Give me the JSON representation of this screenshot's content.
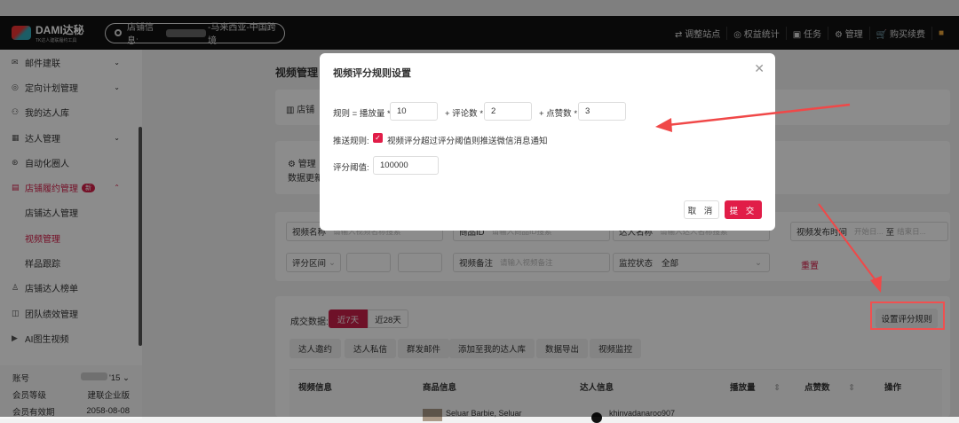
{
  "header": {
    "logo_title": "DAMI达秘",
    "logo_subtitle": "TK达人建联履约工具",
    "store_label": "店铺信息:",
    "store_value": "-马来西亚-中国跨境",
    "nav": [
      "调整站点",
      "权益统计",
      "任务",
      "管理",
      "购买续费"
    ]
  },
  "sidebar": {
    "items": [
      {
        "label": "邮件建联",
        "icon": "mail-icon",
        "chevron": "⌄"
      },
      {
        "label": "定向计划管理",
        "icon": "target-icon",
        "chevron": "⌄"
      },
      {
        "label": "我的达人库",
        "icon": "user-icon"
      },
      {
        "label": "达人管理",
        "icon": "grid-icon",
        "chevron": "⌄"
      },
      {
        "label": "自动化圈人",
        "icon": "auto-icon"
      },
      {
        "label": "店铺履约管理",
        "icon": "store-icon",
        "badge": "新",
        "chevron": "⌃"
      },
      {
        "label": "店铺达人管理"
      },
      {
        "label": "视频管理"
      },
      {
        "label": "样品跟踪"
      },
      {
        "label": "店铺达人榜单",
        "icon": "rank-icon"
      },
      {
        "label": "团队绩效管理",
        "icon": "team-icon"
      },
      {
        "label": "AI图生视频",
        "icon": "video-icon"
      }
    ],
    "account": {
      "account_label": "账号",
      "account_value": "'15",
      "level_label": "会员等级",
      "level_value": "建联企业版",
      "expire_label": "会员有效期",
      "expire_value": "2058-08-08"
    }
  },
  "main": {
    "title": "视频管理",
    "store_tab": "店铺",
    "manage_label": "管理",
    "data_update": "数据更新",
    "filters": {
      "video_name": "视频名称",
      "video_name_ph": "请输入视频名称搜索",
      "product_id": "商品ID",
      "product_id_ph": "请输入商品ID搜索",
      "creator_name": "达人名称",
      "creator_name_ph": "请输入达人名称搜索",
      "publish_time": "视频发布时间",
      "start_ph": "开始日...",
      "to": "至",
      "end_ph": "结束日...",
      "score_range": "评分区间",
      "video_note": "视频备注",
      "video_note_ph": "请输入视频备注",
      "monitor_status": "监控状态",
      "monitor_value": "全部",
      "reset": "重置"
    },
    "deal_label": "成交数据:",
    "range_tabs": [
      "近7天",
      "近28天"
    ],
    "set_rule": "设置评分规则",
    "actions": [
      "达人邀约",
      "达人私信",
      "群发邮件",
      "添加至我的达人库",
      "数据导出",
      "视频监控"
    ],
    "columns": [
      "视频信息",
      "商品信息",
      "达人信息",
      "播放量",
      "点赞数",
      "操作"
    ],
    "row": {
      "product": "Seluar Barbie, Seluar",
      "creator": "khinvadanaroo907"
    }
  },
  "modal": {
    "title": "视频评分规则设置",
    "rule_label": "规则 = 播放量 *",
    "views_weight": "10",
    "comments_label": "+ 评论数 *",
    "comments_weight": "2",
    "likes_label": "+ 点赞数 *",
    "likes_weight": "3",
    "push_label": "推送规则:",
    "push_text": "视频评分超过评分阈值则推送微信消息通知",
    "push_checked": true,
    "threshold_label": "评分阈值:",
    "threshold_value": "100000",
    "cancel": "取 消",
    "submit": "提 交"
  },
  "colors": {
    "accent": "#e11d48",
    "annotation": "#f04848"
  }
}
